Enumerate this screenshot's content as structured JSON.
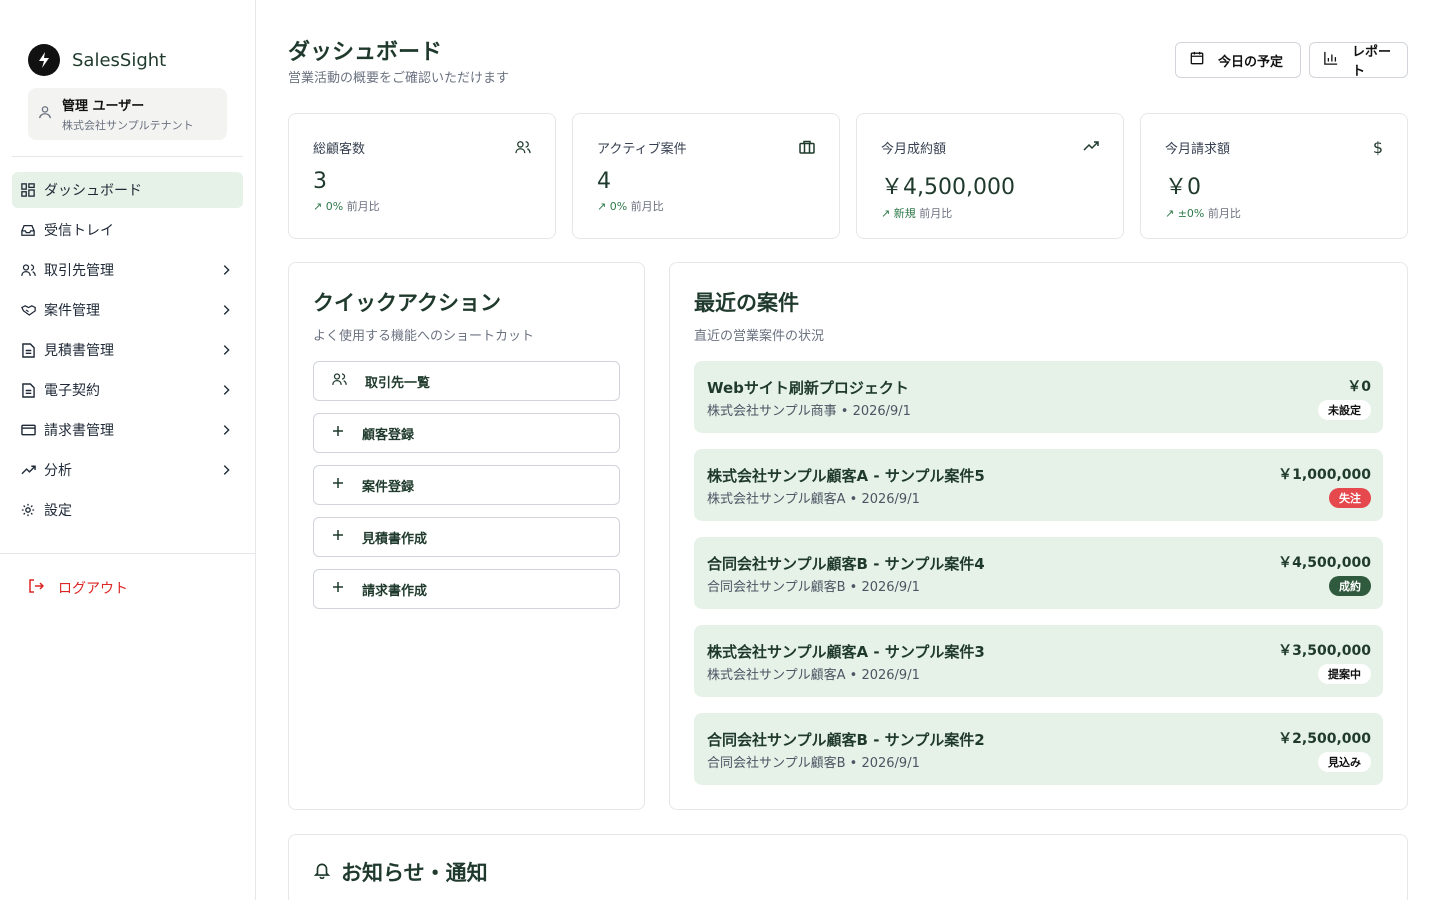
{
  "app": {
    "name": "SalesSight"
  },
  "user": {
    "name": "管理 ユーザー",
    "tenant": "株式会社サンプルテナント"
  },
  "nav": [
    {
      "label": "ダッシュボード",
      "icon": "dashboard-icon",
      "active": true
    },
    {
      "label": "受信トレイ",
      "icon": "inbox-icon"
    },
    {
      "label": "取引先管理",
      "icon": "users-icon"
    },
    {
      "label": "案件管理",
      "icon": "handshake-icon"
    },
    {
      "label": "見積書管理",
      "icon": "document-icon"
    },
    {
      "label": "電子契約",
      "icon": "document-icon"
    },
    {
      "label": "請求書管理",
      "icon": "credit-card-icon"
    },
    {
      "label": "分析",
      "icon": "trending-up-icon"
    },
    {
      "label": "設定",
      "icon": "gear-icon"
    }
  ],
  "logout_label": "ログアウト",
  "header": {
    "title": "ダッシュボード",
    "subtitle": "営業活動の概要をご確認いただけます",
    "schedule_button": "今日の予定",
    "report_button": "レポート"
  },
  "stats": [
    {
      "label": "総顧客数",
      "value": "3",
      "change": "0%",
      "suffix": "前月比",
      "icon": "users-icon"
    },
    {
      "label": "アクティブ案件",
      "value": "4",
      "change": "0%",
      "suffix": "前月比",
      "icon": "briefcase-icon"
    },
    {
      "label": "今月成約額",
      "value": "￥4,500,000",
      "change": "新規",
      "suffix": "前月比",
      "icon": "trending-up-icon"
    },
    {
      "label": "今月請求額",
      "value": "￥0",
      "change": "±0%",
      "suffix": "前月比",
      "icon": "dollar-icon"
    }
  ],
  "quick_actions": {
    "title": "クイックアクション",
    "subtitle": "よく使用する機能へのショートカット",
    "items": [
      {
        "label": "取引先一覧",
        "icon": "users-icon"
      },
      {
        "label": "顧客登録",
        "icon": "plus-icon"
      },
      {
        "label": "案件登録",
        "icon": "plus-icon"
      },
      {
        "label": "見積書作成",
        "icon": "plus-icon"
      },
      {
        "label": "請求書作成",
        "icon": "plus-icon"
      }
    ]
  },
  "recent_deals": {
    "title": "最近の案件",
    "subtitle": "直近の営業案件の状況",
    "items": [
      {
        "title": "Webサイト刷新プロジェクト",
        "company": "株式会社サンプル商事",
        "date": "2026/9/1",
        "amount": "￥0",
        "status": "未設定",
        "status_color": "neutral"
      },
      {
        "title": "株式会社サンプル顧客A - サンプル案件5",
        "company": "株式会社サンプル顧客A",
        "date": "2026/9/1",
        "amount": "￥1,000,000",
        "status": "失注",
        "status_color": "red"
      },
      {
        "title": "合同会社サンプル顧客B - サンプル案件4",
        "company": "合同会社サンプル顧客B",
        "date": "2026/9/1",
        "amount": "￥4,500,000",
        "status": "成約",
        "status_color": "green"
      },
      {
        "title": "株式会社サンプル顧客A - サンプル案件3",
        "company": "株式会社サンプル顧客A",
        "date": "2026/9/1",
        "amount": "￥3,500,000",
        "status": "提案中",
        "status_color": "neutral"
      },
      {
        "title": "合同会社サンプル顧客B - サンプル案件2",
        "company": "合同会社サンプル顧客B",
        "date": "2026/9/1",
        "amount": "￥2,500,000",
        "status": "見込み",
        "status_color": "neutral"
      }
    ]
  },
  "notifications": {
    "title": "お知らせ・通知"
  },
  "colors": {
    "accent": "#1f3a2c",
    "active_bg": "#e6f2e8",
    "danger": "#dc2626",
    "success": "#2f7a4b"
  }
}
